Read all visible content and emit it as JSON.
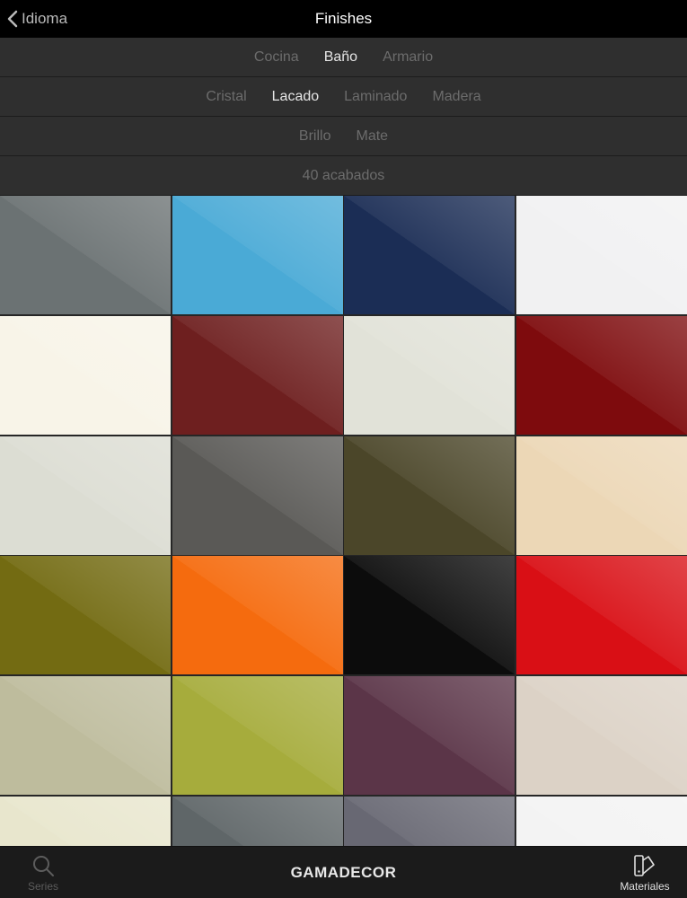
{
  "nav": {
    "back_label": "Idioma",
    "title": "Finishes"
  },
  "filters": {
    "rooms": [
      {
        "label": "Cocina",
        "active": false
      },
      {
        "label": "Baño",
        "active": true
      },
      {
        "label": "Armario",
        "active": false
      }
    ],
    "materials": [
      {
        "label": "Cristal",
        "active": false
      },
      {
        "label": "Lacado",
        "active": true
      },
      {
        "label": "Laminado",
        "active": false
      },
      {
        "label": "Madera",
        "active": false
      }
    ],
    "finish": [
      {
        "label": "Brillo",
        "active": false
      },
      {
        "label": "Mate",
        "active": false
      }
    ],
    "count_label": "40 acabados"
  },
  "swatches": [
    "#6b7273",
    "#4aaad6",
    "#1b2d55",
    "#f1f1f2",
    "#f8f4e8",
    "#6e1f1f",
    "#e1e2d8",
    "#7e0b0d",
    "#dcddd3",
    "#5a5956",
    "#4b4629",
    "#ecd7b6",
    "#736b12",
    "#f56b0e",
    "#0c0c0c",
    "#d90f15",
    "#bebc9d",
    "#a6ac3c",
    "#5b3548",
    "#dcd2c6",
    "#e8e6cd",
    "#5f6668",
    "#686873",
    "#f3f3f3"
  ],
  "tabbar": {
    "series_label": "Series",
    "brand": "GAMADECOR",
    "materials_label": "Materiales"
  }
}
